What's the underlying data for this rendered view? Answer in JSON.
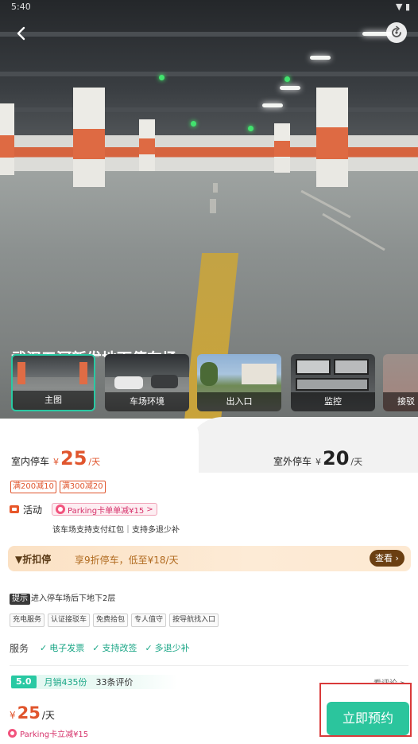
{
  "status": {
    "time": "5:40",
    "icons": "▼ ▮"
  },
  "hero": {
    "title": "武汉五河新发地下停车场",
    "thumbnails": [
      {
        "label": "主图",
        "active": true
      },
      {
        "label": "车场环境",
        "active": false
      },
      {
        "label": "出入口",
        "active": false
      },
      {
        "label": "监控",
        "active": false
      },
      {
        "label": "接驳",
        "active": false
      }
    ]
  },
  "pricing": {
    "indoor": {
      "label": "室内停车",
      "currency": "¥",
      "value": "25",
      "unit": "/天"
    },
    "outdoor": {
      "label": "室外停车",
      "currency": "¥",
      "value": "20",
      "unit": "/天"
    }
  },
  "coupons": [
    "满200减10",
    "满300减20"
  ],
  "activity": {
    "label": "活动",
    "parking_tag": "Parking卡单单减¥15",
    "note": "该车场支持支付红包｜支持多退少补"
  },
  "discount": {
    "label": "折扣停",
    "text": "享9折停车，低至¥18/天",
    "button": "查看"
  },
  "tip": {
    "tag": "提示",
    "text": "进入停车场后下地下2层"
  },
  "features": [
    "充电服务",
    "认证接驳车",
    "免费拾包",
    "专人值守",
    "按导航找入口"
  ],
  "services": {
    "label": "服务",
    "items": [
      "电子发票",
      "支持改签",
      "多退少补"
    ]
  },
  "rating": {
    "score": "5.0",
    "sales": "月销435份",
    "reviews": "33条评价",
    "view_all": "看评论 >"
  },
  "bottom": {
    "currency": "¥",
    "price": "25",
    "unit": "/天",
    "promo": "Parking卡立减¥15",
    "book_button": "立即预约"
  },
  "colors": {
    "accent": "#2bc59d",
    "price": "#e0552d",
    "parking_pink": "#d6316a",
    "highlight_box": "#d93a3a"
  }
}
